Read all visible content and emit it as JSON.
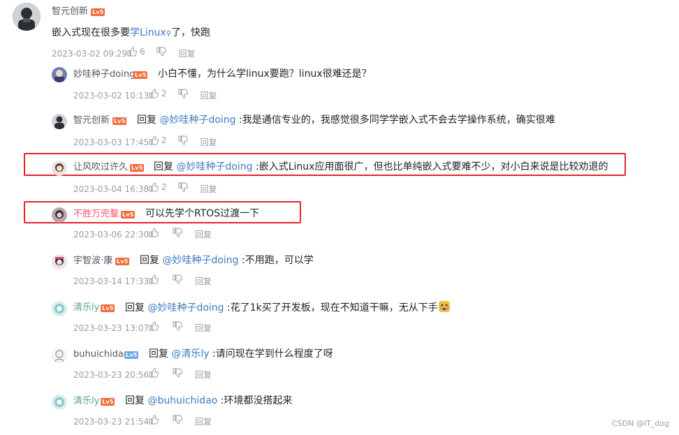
{
  "main_comment": {
    "username": "智元创新",
    "level_badge": "Lv5",
    "text_prefix": "嵌入式现在很多要",
    "keyword_link": "学Linux",
    "text_suffix": "了，快跑",
    "time": "2023-03-02 09:29",
    "likes": "6",
    "reply_label": "回复"
  },
  "replies": [
    {
      "username": "妙哇种子doing",
      "level_badge": "Lv5",
      "reply_word": "",
      "mention": "",
      "text": "小白不懂，为什么学linux要跑？linux很难还是？",
      "time": "2023-03-02 10:13",
      "likes": "2",
      "reply_label": "回复"
    },
    {
      "username": "智元创新",
      "level_badge": "Lv5",
      "reply_word": "回复",
      "mention": "@妙哇种子doing",
      "text": ":我是通信专业的，我感觉很多同学学嵌入式不会去学操作系统，确实很难",
      "time": "2023-03-03 17:45",
      "likes": "2",
      "reply_label": "回复"
    },
    {
      "username": "让风吹过许久",
      "level_badge": "Lv5",
      "reply_word": "回复",
      "mention": "@妙哇种子doing",
      "text": ":嵌入式Linux应用面很广，但也比单纯嵌入式要难不少，对小白来说是比较劝退的",
      "time": "2023-03-04 16:38",
      "likes": "2",
      "reply_label": "回复"
    },
    {
      "username": "不胜万兜鍪",
      "level_badge": "Lv5",
      "reply_word": "",
      "mention": "",
      "text": "可以先学个RTOS过渡一下",
      "time": "2023-03-06 22:30",
      "likes": "",
      "reply_label": "回复"
    },
    {
      "username": "宇智波·康",
      "level_badge": "Lv5",
      "reply_word": "回复",
      "mention": "@妙哇种子doing",
      "text": ":不用跑，可以学",
      "time": "2023-03-14 17:33",
      "likes": "",
      "reply_label": "回复"
    },
    {
      "username": "清乐ly",
      "level_badge": "Lv5",
      "reply_word": "回复",
      "mention": "@妙哇种子doing",
      "text": ":花了1k买了开发板，现在不知道干嘛，无从下手",
      "time": "2023-03-23 13:07",
      "likes": "",
      "reply_label": "回复"
    },
    {
      "username": "buhuichidao",
      "level_badge": "Lv5",
      "reply_word": "回复",
      "mention": "@清乐ly",
      "text": ":请问现在学到什么程度了呀",
      "time": "2023-03-23 20:56",
      "likes": "",
      "reply_label": "回复"
    },
    {
      "username": "清乐ly",
      "level_badge": "Lv5",
      "reply_word": "回复",
      "mention": "@buhuichidao",
      "text": ":环境都没搭起来",
      "time": "2023-03-23 21:54",
      "likes": "",
      "reply_label": "回复"
    }
  ],
  "watermark": "CSDN @IT_dog",
  "colors": {
    "mention": "#3d7ac1",
    "meta": "#999aaa",
    "highlight": "#e8222a",
    "level_badge": "#f26b3a",
    "pink_name": "#fc5572"
  }
}
